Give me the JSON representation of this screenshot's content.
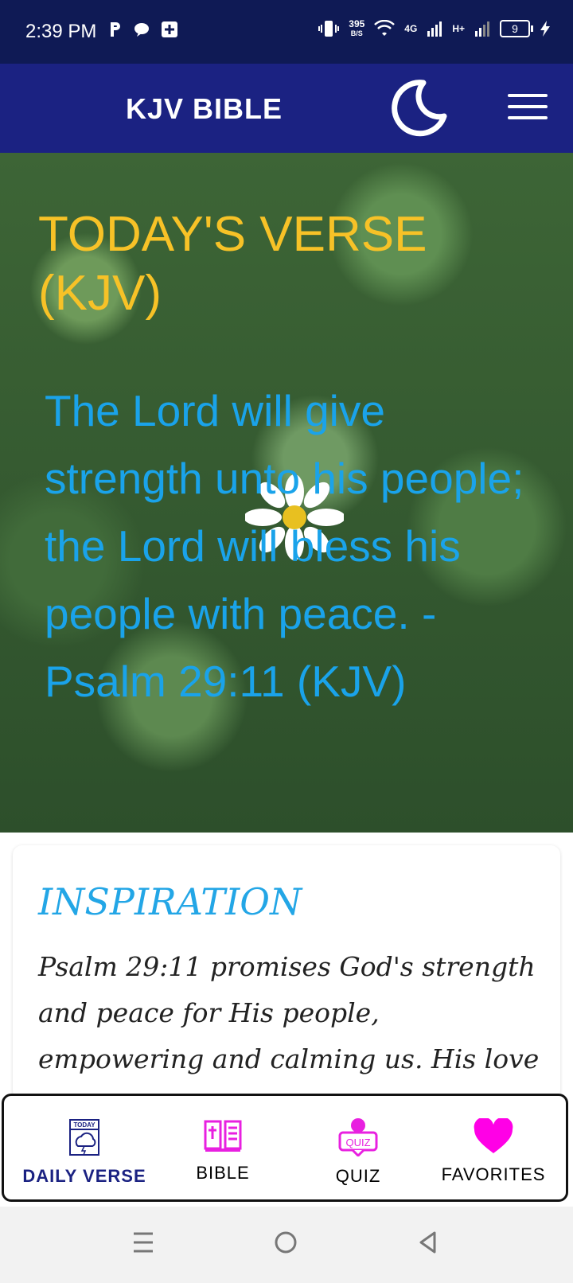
{
  "status_bar": {
    "time": "2:39 PM",
    "speed_value": "395",
    "speed_unit": "B/S",
    "network_4g": "4G",
    "network_h": "H+",
    "battery_level": "9"
  },
  "app_bar": {
    "title": "KJV BIBLE"
  },
  "hero": {
    "heading": "TODAY'S VERSE (KJV)",
    "verse": "The Lord will give strength unto his people; the Lord will bless his people with peace. - Psalm 29:11 (KJV)"
  },
  "inspiration": {
    "title": "INSPIRATION",
    "body": "Psalm 29:11 promises God's strength and peace for His people, empowering and calming us. His love sustains,"
  },
  "bottom_nav": {
    "items": [
      {
        "label": "DAILY VERSE",
        "icon": "calendar-today-icon",
        "active": true
      },
      {
        "label": "BIBLE",
        "icon": "bible-book-icon",
        "active": false
      },
      {
        "label": "QUIZ",
        "icon": "quiz-icon",
        "active": false
      },
      {
        "label": "FAVORITES",
        "icon": "heart-icon",
        "active": false
      }
    ],
    "today_icon_text": "TODAY",
    "quiz_icon_text": "QUIZ"
  },
  "colors": {
    "status_bar": "#0f1a55",
    "app_bar": "#1b2282",
    "heading": "#f7c227",
    "verse": "#1aa3ea",
    "accent_magenta": "#e820e0"
  }
}
